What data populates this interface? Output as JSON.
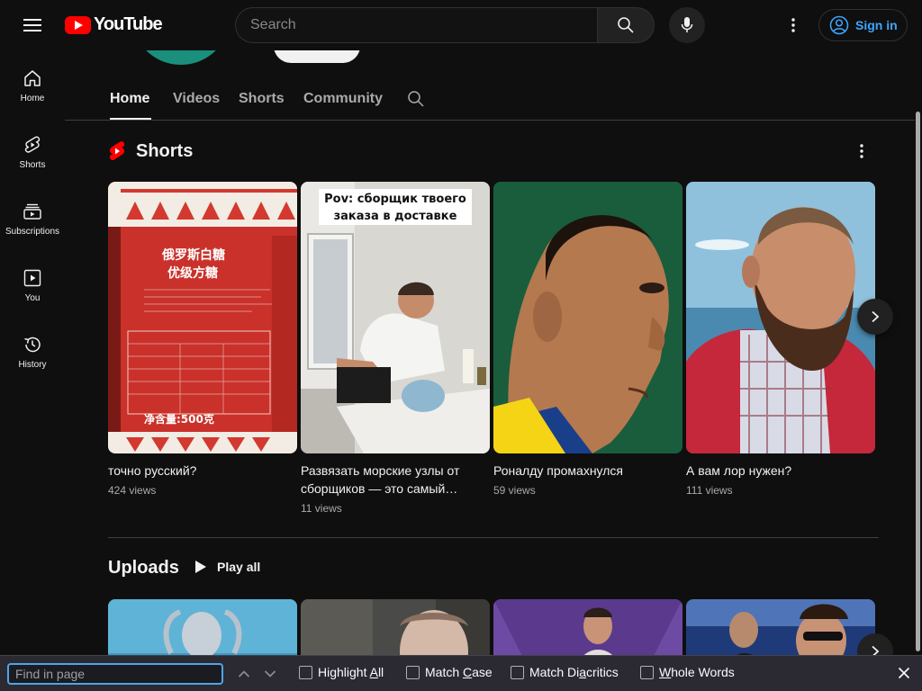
{
  "masthead": {
    "logo_text": "YouTube",
    "search_placeholder": "Search",
    "sign_in_label": "Sign in"
  },
  "sidebar": {
    "items": [
      {
        "label": "Home",
        "icon": "home-icon"
      },
      {
        "label": "Shorts",
        "icon": "shorts-icon"
      },
      {
        "label": "Subscriptions",
        "icon": "subscriptions-icon"
      },
      {
        "label": "You",
        "icon": "you-icon"
      },
      {
        "label": "History",
        "icon": "history-icon"
      }
    ]
  },
  "channel": {
    "tabs": [
      "Home",
      "Videos",
      "Shorts",
      "Community"
    ],
    "active_tab": "Home"
  },
  "shorts_section": {
    "title": "Shorts",
    "cards": [
      {
        "title": "точно русский?",
        "views": "424 views"
      },
      {
        "title": "Развязать морские узлы от сборщиков — это самый…",
        "views": "11 views",
        "overlay": "Pov: сборщик твоего заказа в доставке"
      },
      {
        "title": "Роналду промахнулся",
        "views": "59 views"
      },
      {
        "title": "А вам лор нужен?",
        "views": "111 views"
      }
    ],
    "thumb_text": {
      "line1": "俄罗斯白糖",
      "line2": "优级方糖",
      "net": "净含量:500克"
    }
  },
  "uploads_section": {
    "title": "Uploads",
    "play_all_label": "Play all"
  },
  "find_bar": {
    "placeholder": "Find in page",
    "options": {
      "highlight_pre": "Highlight ",
      "highlight_u": "A",
      "highlight_post": "ll",
      "case_pre": "Match ",
      "case_u": "C",
      "case_post": "ase",
      "diac_pre": "Match Di",
      "diac_u": "a",
      "diac_post": "critics",
      "whole_u": "W",
      "whole_post": "hole Words"
    }
  },
  "colors": {
    "background": "#0f0f0f",
    "brand_red": "#ff0000",
    "link_blue": "#3ea6ff",
    "findbar_bg": "#2b2a33"
  }
}
